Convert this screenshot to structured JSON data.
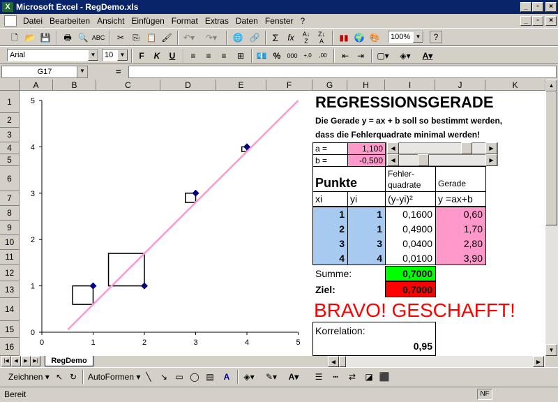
{
  "window": {
    "title": "Microsoft Excel - RegDemo.xls"
  },
  "menu": [
    "Datei",
    "Bearbeiten",
    "Ansicht",
    "Einfügen",
    "Format",
    "Extras",
    "Daten",
    "Fenster",
    "?"
  ],
  "toolbar": {
    "zoom": "100%",
    "font": "Arial",
    "size": "10",
    "bold": "F",
    "italic": "K",
    "underline": "U",
    "sum": "Σ",
    "fx": "fx",
    "percent": "%",
    "thousands": "000"
  },
  "namebox": "G17",
  "formula_eq": "=",
  "columns": [
    "A",
    "B",
    "C",
    "D",
    "E",
    "F",
    "G",
    "H",
    "I",
    "J",
    "K"
  ],
  "rows": [
    "1",
    "2",
    "3",
    "4",
    "5",
    "6",
    "7",
    "8",
    "9",
    "10",
    "11",
    "12",
    "13",
    "14",
    "15",
    "16"
  ],
  "sheet": {
    "title": "REGRESSIONSGERADE",
    "desc1": "Die Gerade y = ax + b soll so bestimmt werden,",
    "desc2": "dass die Fehlerquadrate minimal werden!",
    "a_label": "a =",
    "a_value": "1,100",
    "b_label": "b =",
    "b_value": "-0,500",
    "a_slider": 0.82,
    "b_slider": 0.25,
    "punkte": "Punkte",
    "fehler_header": "Fehler-\nquadrate",
    "gerade_header": "Gerade",
    "h_xi": "xi",
    "h_yi": "yi",
    "h_err": "(y-yi)²",
    "h_fit": "y =ax+b",
    "data_rows": [
      {
        "xi": "1",
        "yi": "1",
        "err": "0,1600",
        "fit": "0,60"
      },
      {
        "xi": "2",
        "yi": "1",
        "err": "0,4900",
        "fit": "1,70"
      },
      {
        "xi": "3",
        "yi": "3",
        "err": "0,0400",
        "fit": "2,80"
      },
      {
        "xi": "4",
        "yi": "4",
        "err": "0,0100",
        "fit": "3,90"
      }
    ],
    "summe_label": "Summe:",
    "summe_value": "0,7000",
    "ziel_label": "Ziel:",
    "ziel_value": "0,7000",
    "bravo": "BRAVO! GESCHAFFT!",
    "korrelation_label": "Korrelation:",
    "korrelation_value": "0,95"
  },
  "chart_data": {
    "type": "scatter",
    "points": [
      {
        "x": 1,
        "y": 1
      },
      {
        "x": 2,
        "y": 1
      },
      {
        "x": 3,
        "y": 3
      },
      {
        "x": 4,
        "y": 4
      }
    ],
    "line": {
      "slope": 1.1,
      "intercept": -0.5
    },
    "xlim": [
      0,
      5
    ],
    "ylim": [
      0,
      5
    ],
    "xticks": [
      "0",
      "1",
      "2",
      "3",
      "4",
      "5"
    ],
    "yticks": [
      "0",
      "1",
      "2",
      "3",
      "4",
      "5"
    ],
    "colors": {
      "points": "#000080",
      "line": "#ff99cc",
      "squares": "#000000"
    }
  },
  "sheet_tab": "RegDemo",
  "drawing": {
    "zeichnen": "Zeichnen",
    "autoformen": "AutoFormen"
  },
  "status": {
    "left": "Bereit",
    "nf": "NF"
  },
  "colors": {
    "title_bar": "#0a246a",
    "xi_fill": "#a6caf0",
    "fit_fill": "#ff99cc",
    "summe_fill": "#00ff00",
    "ziel_fill": "#ff0000",
    "bravo_text": "#ff0000"
  }
}
